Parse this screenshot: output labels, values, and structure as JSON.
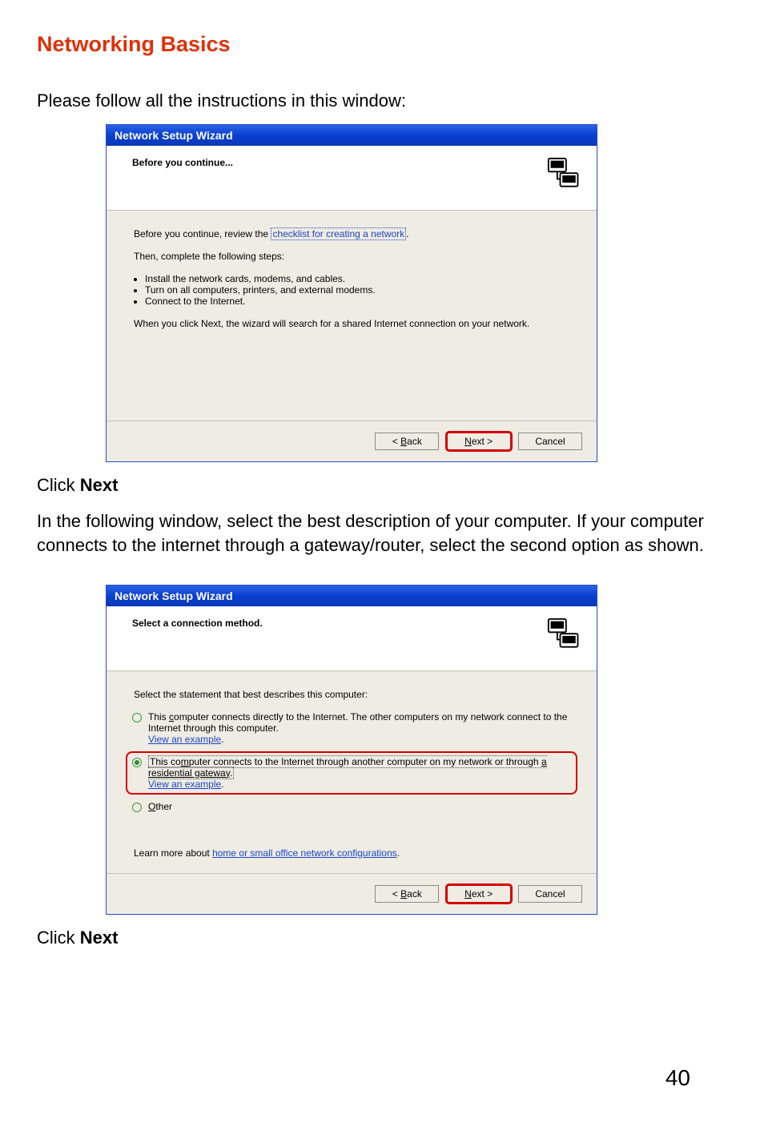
{
  "page": {
    "title": "Networking Basics",
    "intro": "Please follow all the instructions in this window:",
    "clickNextPrefix": "Click ",
    "clickNextBold": "Next",
    "middleText": "In the following window, select the best description of your computer. If your computer connects to the internet through a gateway/router, select the second option as shown.",
    "pageNumber": "40"
  },
  "dialog1": {
    "title": "Network Setup Wizard",
    "header": "Before you continue...",
    "reviewPrefix": "Before you continue, review the ",
    "reviewLink": "checklist for creating a network",
    "reviewSuffix": ".",
    "thenLine": "Then, complete the following steps:",
    "bullets": [
      "Install the network cards, modems, and cables.",
      "Turn on all computers, printers, and external modems.",
      "Connect to the Internet."
    ],
    "searchLine": "When you click Next, the wizard will search for a shared Internet connection on your network.",
    "buttons": {
      "back": "< Back",
      "next": "Next >",
      "cancel": "Cancel"
    }
  },
  "dialog2": {
    "title": "Network Setup Wizard",
    "header": "Select a connection method.",
    "intro": "Select the statement that best describes this computer:",
    "opt1": {
      "textA": "This ",
      "textUL": "c",
      "textB": "omputer connects directly to the Internet. The other computers on my network connect to the Internet through this computer.",
      "example": "View an example"
    },
    "opt2": {
      "textA": "This co",
      "textUL": "m",
      "textB": "puter connects to the Internet through another computer on my network or through ",
      "gateway": "a residential gateway",
      "textC": ".",
      "example": "View an example"
    },
    "opt3": {
      "ul": "O",
      "rest": "ther"
    },
    "learnPrefix": "Learn more about ",
    "learnLink": "home or small office network configurations",
    "learnSuffix": ".",
    "buttons": {
      "back": "< Back",
      "next": "Next >",
      "cancel": "Cancel"
    }
  }
}
